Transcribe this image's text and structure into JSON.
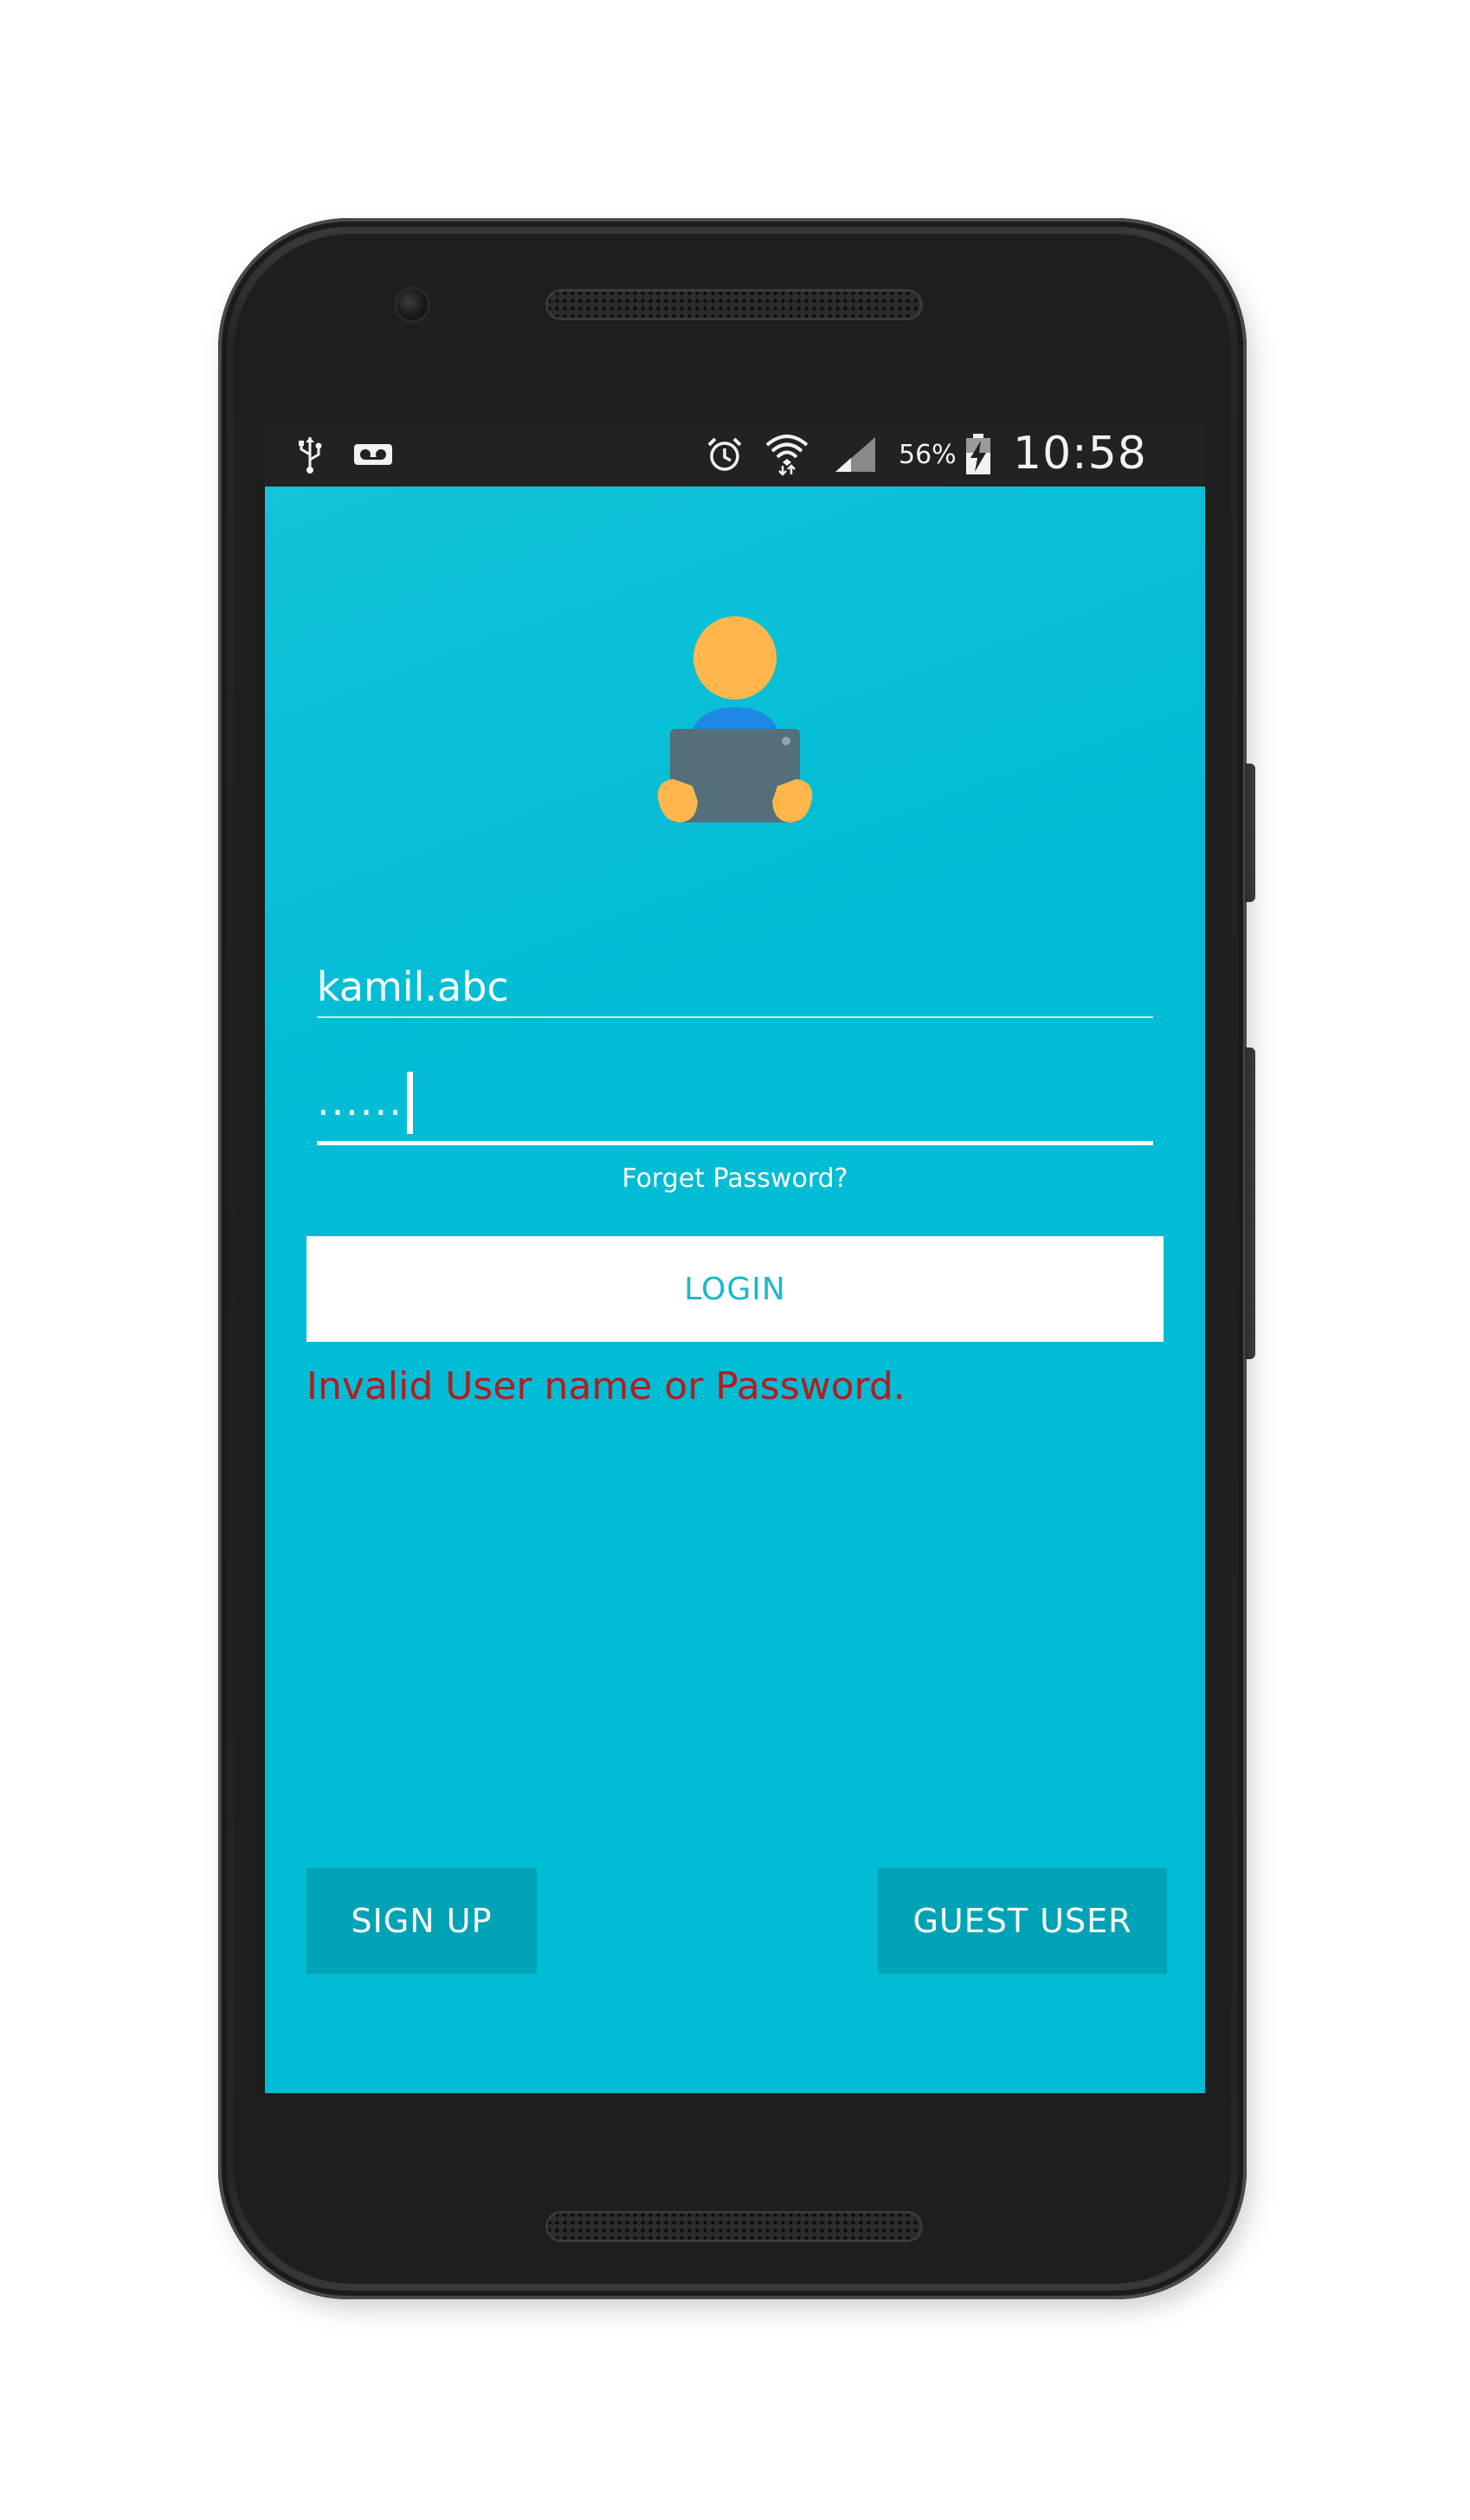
{
  "status_bar": {
    "left_icons": [
      "usb-icon",
      "voicemail-icon"
    ],
    "right_icons": [
      "alarm-icon",
      "wifi-icon",
      "signal-icon",
      "battery-charging-icon"
    ],
    "battery_percent": "56%",
    "time": "10:58 PM"
  },
  "login_screen": {
    "avatar_icon": "user-with-laptop-icon",
    "username_value": "kamil.abc",
    "password_value": ".......",
    "forgot_password_label": "Forget Password?",
    "login_button_label": "LOGIN",
    "error_message": "Invalid User name or Password.",
    "signup_button_label": "SIGN UP",
    "guest_button_label": "GUEST USER"
  },
  "colors": {
    "background": "#00bcd4",
    "status_bar": "#222222",
    "login_button_bg": "#ffffff",
    "login_button_text": "#19b8cb",
    "error_text": "#b71c1c",
    "secondary_button_bg": "#00a3b5",
    "avatar_head": "#ffb74d",
    "avatar_body": "#1e88e5",
    "avatar_laptop": "#546e7a"
  }
}
